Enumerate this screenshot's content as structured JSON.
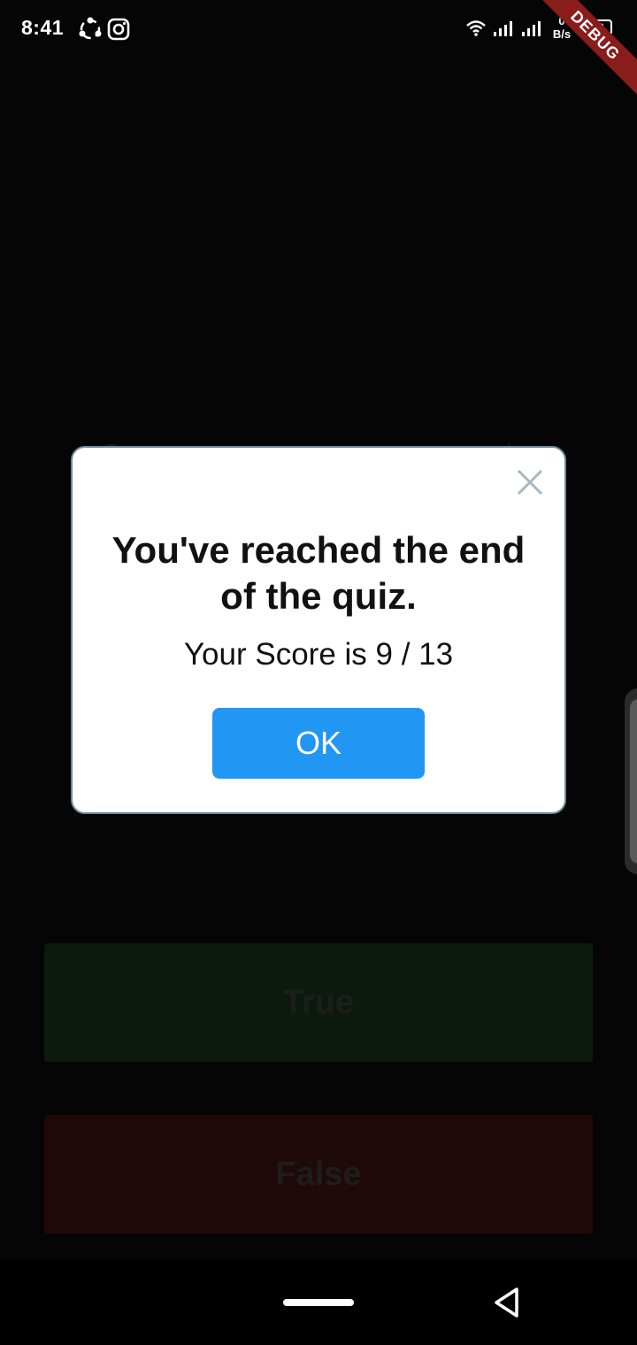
{
  "status_bar": {
    "time": "8:41",
    "net_speed_value": "0",
    "net_speed_unit": "B/s",
    "battery": "23",
    "icons": [
      "sync-icon",
      "instagram-icon",
      "wifi-icon",
      "signal-icon",
      "signal-icon"
    ]
  },
  "debug_banner": "DEBUG",
  "background_screen": {
    "true_label": "True",
    "false_label": "False",
    "true_color": "#0b1a0d",
    "false_color": "#200909"
  },
  "dialog": {
    "title": "You've reached the end of the quiz.",
    "score_text": "Your Score is 9 / 13",
    "ok_label": "OK",
    "ok_color": "#2196f3",
    "close_icon": "close-icon"
  },
  "nav_bar": {
    "icons": [
      "home-pill",
      "back-icon"
    ]
  }
}
